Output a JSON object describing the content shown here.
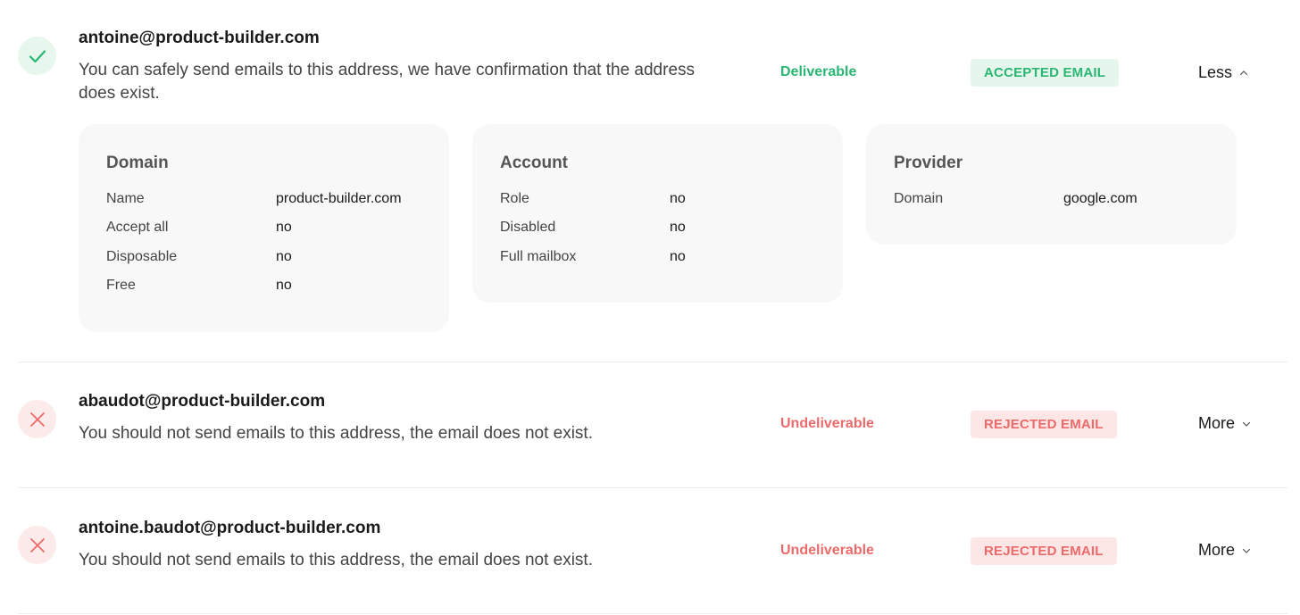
{
  "results": [
    {
      "email": "antoine@product-builder.com",
      "description": "You can safely send emails to this address, we have confirmation that the address does exist.",
      "verdict": "Deliverable",
      "badge": "ACCEPTED EMAIL",
      "toggle": "Less",
      "status_icon": "check-icon",
      "toggle_icon": "chevron-up-icon",
      "details": {
        "domain": {
          "title": "Domain",
          "rows": [
            {
              "key": "Name",
              "value": "product-builder.com"
            },
            {
              "key": "Accept all",
              "value": "no"
            },
            {
              "key": "Disposable",
              "value": "no"
            },
            {
              "key": "Free",
              "value": "no"
            }
          ]
        },
        "account": {
          "title": "Account",
          "rows": [
            {
              "key": "Role",
              "value": "no"
            },
            {
              "key": "Disabled",
              "value": "no"
            },
            {
              "key": "Full mailbox",
              "value": "no"
            }
          ]
        },
        "provider": {
          "title": "Provider",
          "rows": [
            {
              "key": "Domain",
              "value": "google.com"
            }
          ]
        }
      }
    },
    {
      "email": "abaudot@product-builder.com",
      "description": "You should not send emails to this address, the email does not exist.",
      "verdict": "Undeliverable",
      "badge": "REJECTED EMAIL",
      "toggle": "More",
      "status_icon": "x-icon",
      "toggle_icon": "chevron-down-icon"
    },
    {
      "email": "antoine.baudot@product-builder.com",
      "description": "You should not send emails to this address, the email does not exist.",
      "verdict": "Undeliverable",
      "badge": "REJECTED EMAIL",
      "toggle": "More",
      "status_icon": "x-icon",
      "toggle_icon": "chevron-down-icon"
    }
  ],
  "colors": {
    "success": "#2ab673",
    "success_bg": "#e6f6ec",
    "error": "#ec6a6a",
    "error_bg": "#fde6e6",
    "card_bg": "#f8f8f8"
  }
}
